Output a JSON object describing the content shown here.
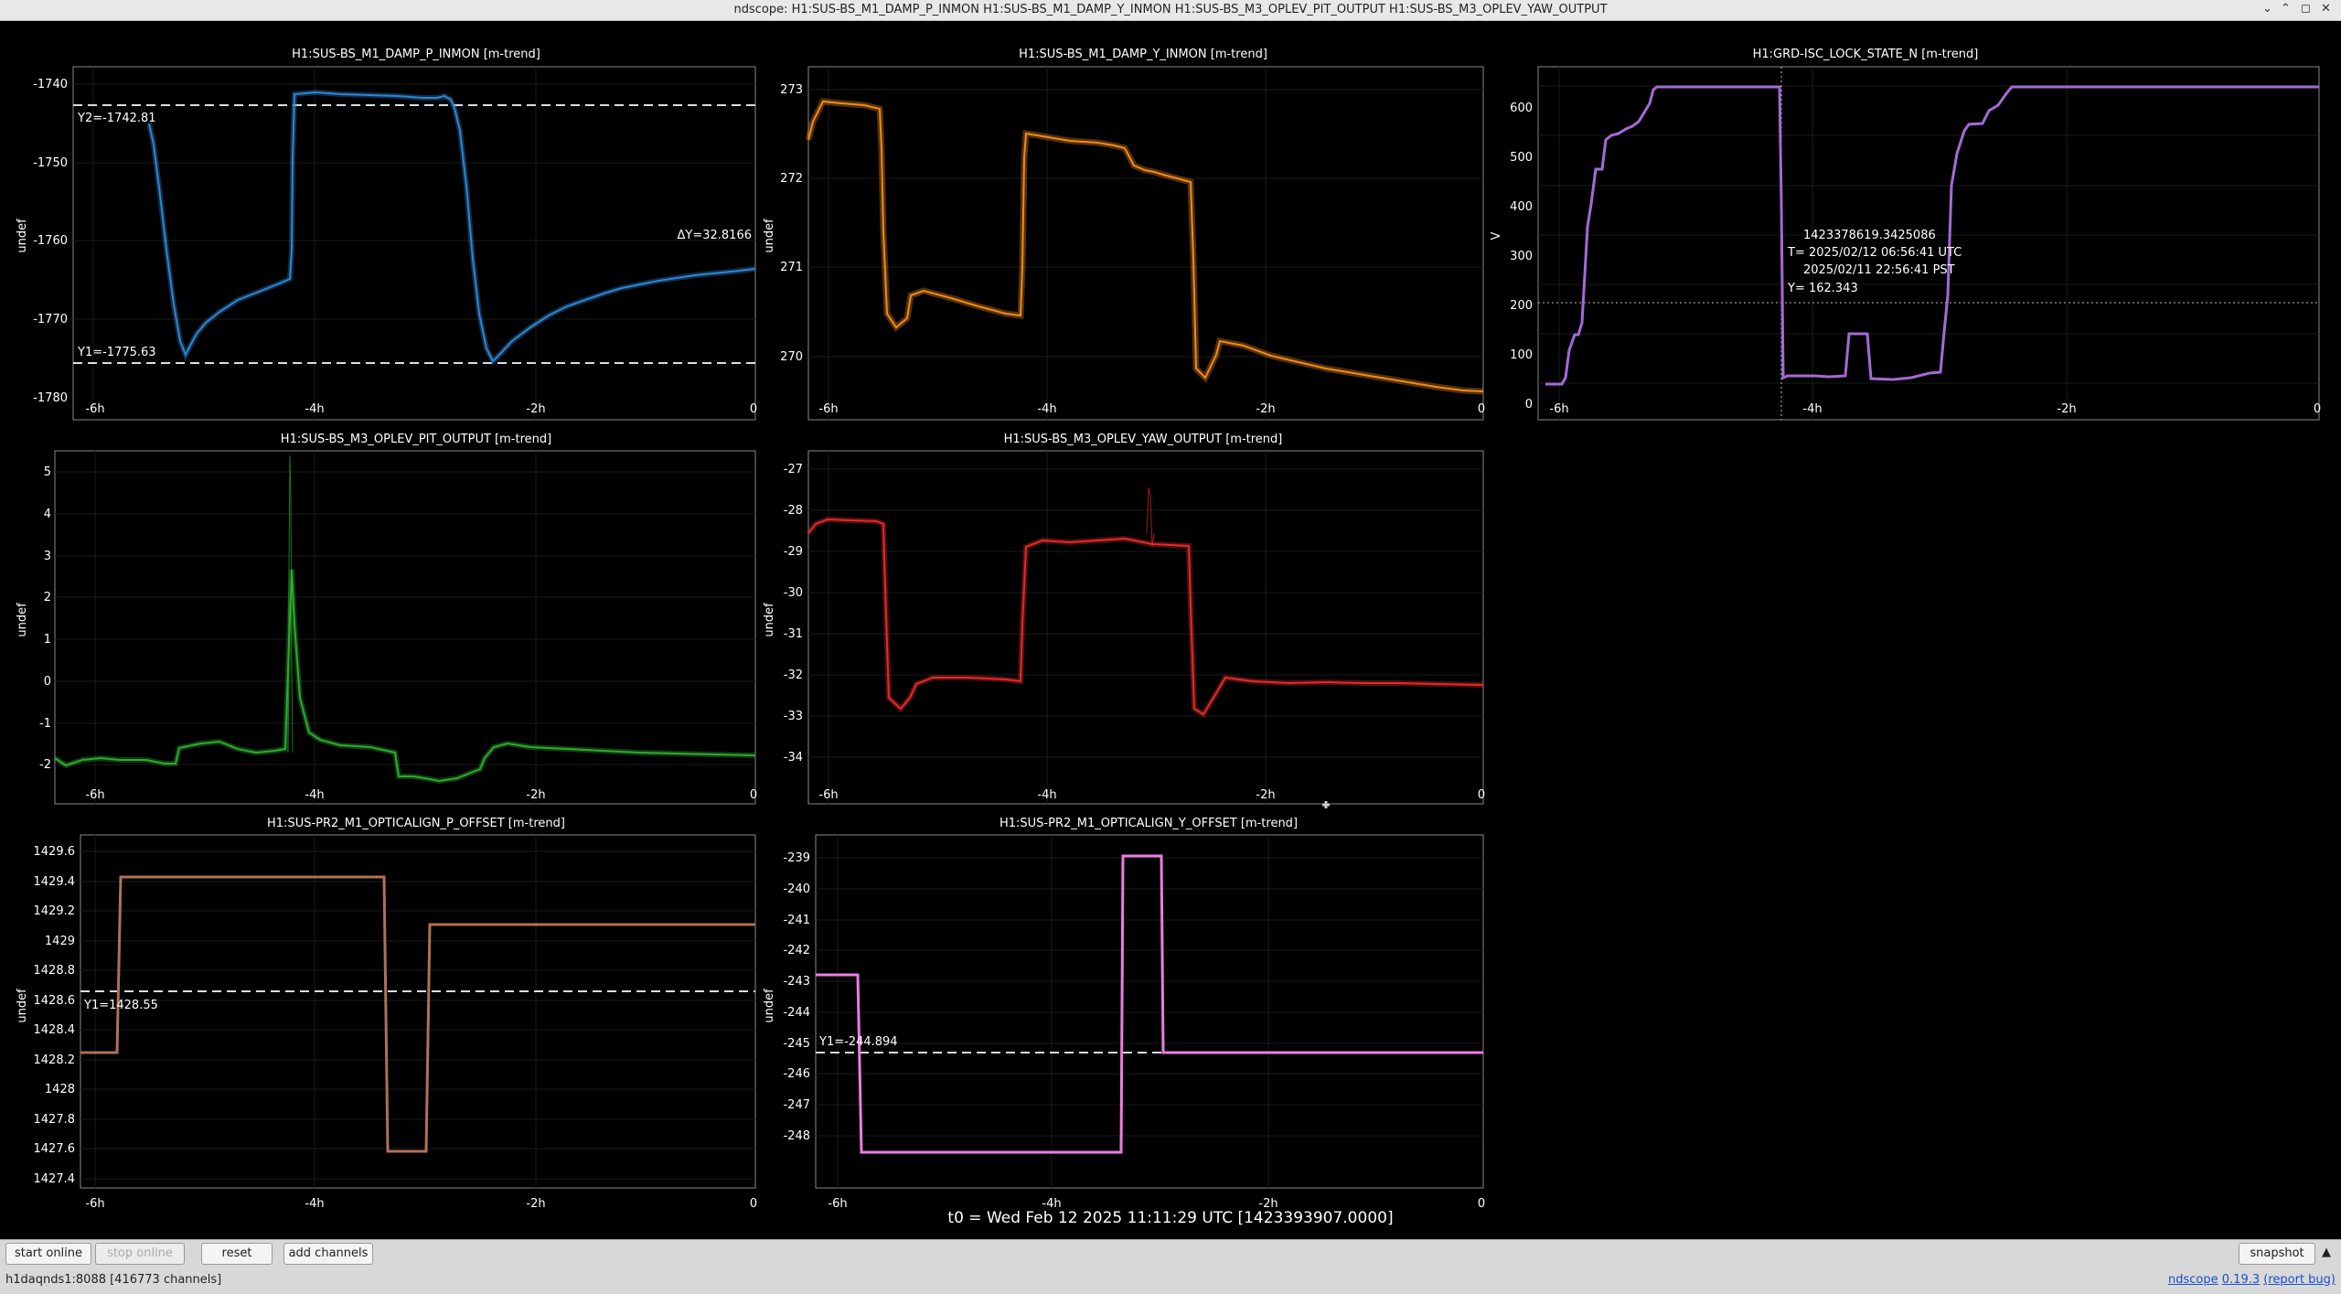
{
  "window": {
    "title": "ndscope: H1:SUS-BS_M1_DAMP_P_INMON H1:SUS-BS_M1_DAMP_Y_INMON H1:SUS-BS_M3_OPLEV_PIT_OUTPUT H1:SUS-BS_M3_OPLEV_YAW_OUTPUT"
  },
  "t0_label": "t0 = Wed Feb 12 2025 11:11:29 UTC [1423393907.0000]",
  "toolbar": {
    "start_online": "start online",
    "stop_online": "stop online",
    "reset": "reset",
    "add_channels": "add channels",
    "snapshot": "snapshot",
    "expand": "▲"
  },
  "status": {
    "server": "h1daqnds1:8088  [416773 channels]",
    "app": "ndscope",
    "version": "0.19.3",
    "report_bug": "(report bug)"
  },
  "colors": {
    "p_inmon": "#2f85d0",
    "y_inmon": "#f08a1c",
    "lock_state": "#a46ad6",
    "pit": "#2eaa2e",
    "yaw": "#e22a2a",
    "pr2_p": "#b0705c",
    "pr2_y": "#ee7ce4"
  },
  "x_tick_labels": [
    "-6h",
    "-4h",
    "-2h",
    "0"
  ],
  "plots": {
    "p_inmon": {
      "title": "H1:SUS-BS_M1_DAMP_P_INMON [m-trend]",
      "ylabel": "undef",
      "yticks": [
        "-1740",
        "-1750",
        "-1760",
        "-1770",
        "-1780"
      ],
      "cursor_y2": "Y2=-1742.81",
      "cursor_y1": "Y1=-1775.63",
      "delta": "ΔY=32.8166"
    },
    "y_inmon": {
      "title": "H1:SUS-BS_M1_DAMP_Y_INMON [m-trend]",
      "ylabel": "undef",
      "yticks": [
        "273",
        "272",
        "271",
        "270"
      ]
    },
    "lock_state": {
      "title": "H1:GRD-ISC_LOCK_STATE_N [m-trend]",
      "ylabel": "V",
      "yticks": [
        "600",
        "500",
        "400",
        "300",
        "200",
        "100",
        "0"
      ],
      "cursor_gps": "1423378619.3425086",
      "cursor_utc": "T= 2025/02/12 06:56:41 UTC",
      "cursor_pst": "2025/02/11 22:56:41 PST",
      "cursor_y": "Y= 162.343"
    },
    "pit": {
      "title": "H1:SUS-BS_M3_OPLEV_PIT_OUTPUT [m-trend]",
      "ylabel": "undef",
      "yticks": [
        "5",
        "4",
        "3",
        "2",
        "1",
        "0",
        "-1",
        "-2"
      ]
    },
    "yaw": {
      "title": "H1:SUS-BS_M3_OPLEV_YAW_OUTPUT [m-trend]",
      "ylabel": "undef",
      "yticks": [
        "-27",
        "-28",
        "-29",
        "-30",
        "-31",
        "-32",
        "-33",
        "-34"
      ]
    },
    "pr2_p": {
      "title": "H1:SUS-PR2_M1_OPTICALIGN_P_OFFSET [m-trend]",
      "ylabel": "undef",
      "yticks": [
        "1429.6",
        "1429.4",
        "1429.2",
        "1429",
        "1428.8",
        "1428.6",
        "1428.4",
        "1428.2",
        "1428",
        "1427.8",
        "1427.6",
        "1427.4"
      ],
      "cursor_y1": "Y1=1428.55"
    },
    "pr2_y": {
      "title": "H1:SUS-PR2_M1_OPTICALIGN_Y_OFFSET [m-trend]",
      "ylabel": "undef",
      "yticks": [
        "-239",
        "-240",
        "-241",
        "-242",
        "-243",
        "-244",
        "-245",
        "-246",
        "-247",
        "-248"
      ],
      "cursor_y1": "Y1=-244.894"
    }
  }
}
